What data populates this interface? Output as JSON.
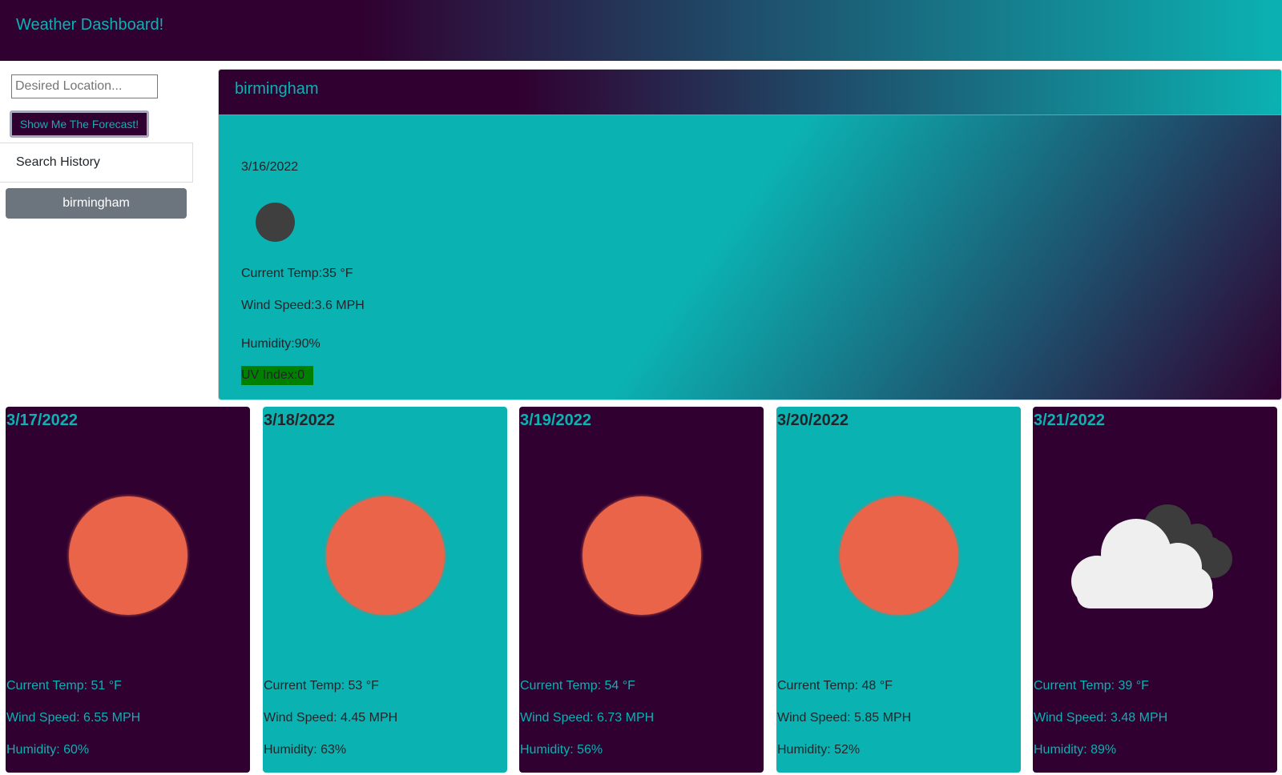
{
  "header": {
    "title": "Weather Dashboard!"
  },
  "search": {
    "placeholder": "Desired Location...",
    "value": "",
    "button_label": "Show Me The Forecast!"
  },
  "history": {
    "title": "Search History",
    "items": [
      "birmingham"
    ]
  },
  "current": {
    "city": "birmingham",
    "date": "3/16/2022",
    "icon": "moon-icon",
    "temp": "Current Temp:35 °F",
    "wind": "Wind Speed:3.6 MPH",
    "humidity": "Humidity:90%",
    "uv": "UV Index:0",
    "uv_color": "#008000"
  },
  "forecast": [
    {
      "date": "3/17/2022",
      "icon": "sun-icon",
      "temp": "Current Temp: 51 °F",
      "wind": "Wind Speed: 6.55 MPH",
      "humidity": "Humidity: 60%"
    },
    {
      "date": "3/18/2022",
      "icon": "sun-icon",
      "temp": "Current Temp: 53 °F",
      "wind": "Wind Speed: 4.45 MPH",
      "humidity": "Humidity: 63%"
    },
    {
      "date": "3/19/2022",
      "icon": "sun-icon",
      "temp": "Current Temp: 54 °F",
      "wind": "Wind Speed: 6.73 MPH",
      "humidity": "Humidity: 56%"
    },
    {
      "date": "3/20/2022",
      "icon": "sun-icon",
      "temp": "Current Temp: 48 °F",
      "wind": "Wind Speed: 5.85 MPH",
      "humidity": "Humidity: 52%"
    },
    {
      "date": "3/21/2022",
      "icon": "cloud-icon",
      "temp": "Current Temp: 39 °F",
      "wind": "Wind Speed: 3.48 MPH",
      "humidity": "Humidity: 89%"
    }
  ],
  "colors": {
    "dark": "#300030",
    "teal": "#0bb2b2",
    "sun": "#e96448",
    "history_button": "#6c757d"
  }
}
